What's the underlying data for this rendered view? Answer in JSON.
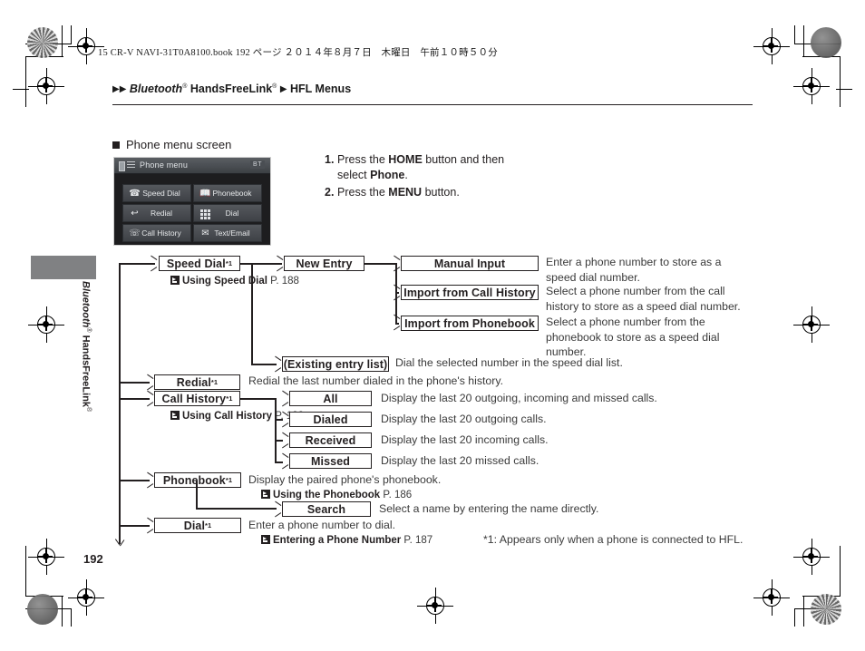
{
  "header": {
    "filestamp": "15 CR-V NAVI-31T0A8100.book   192 ページ   ２０１４年８月７日　木曜日　午前１０時５０分",
    "breadcrumb_1": "Bluetooth",
    "breadcrumb_1_sup": "®",
    "breadcrumb_2": "HandsFreeLink",
    "breadcrumb_2_sup": "®",
    "breadcrumb_3": "HFL Menus"
  },
  "sidebar": {
    "label_1": "Bluetooth",
    "label_1_sup": "®",
    "label_2": "HandsFreeLink",
    "label_2_sup": "®"
  },
  "section": {
    "title": "Phone menu screen"
  },
  "device": {
    "title": "Phone menu",
    "status_right": "BT",
    "buttons": [
      {
        "label": "Speed Dial",
        "icon": "speed-dial-icon"
      },
      {
        "label": "Phonebook",
        "icon": "phonebook-icon"
      },
      {
        "label": "Redial",
        "icon": "redial-icon"
      },
      {
        "label": "Dial",
        "icon": "keypad-icon"
      },
      {
        "label": "Call History",
        "icon": "call-history-icon"
      },
      {
        "label": "Text/Email",
        "icon": "envelope-icon"
      }
    ]
  },
  "steps": [
    {
      "num": "1.",
      "pre": "Press the ",
      "bold1": "HOME",
      "mid": " button and then",
      "line2_pre": "select ",
      "bold2": "Phone",
      "line2_post": "."
    },
    {
      "num": "2.",
      "pre": "Press the ",
      "bold1": "MENU",
      "mid": " button.",
      "line2_pre": "",
      "bold2": "",
      "line2_post": ""
    }
  ],
  "flow": {
    "speed_dial": {
      "label": "Speed Dial",
      "sup": "*1"
    },
    "speed_dial_ref": {
      "bold": "Using Speed Dial",
      "page": "P. 188"
    },
    "new_entry": {
      "label": "New Entry"
    },
    "manual_input": {
      "label": "Manual Input"
    },
    "manual_input_desc": "Enter a phone number to store as a speed dial number.",
    "import_call_history": {
      "label": "Import from Call History"
    },
    "import_call_history_desc": "Select a phone number from the call history to store as a speed dial number.",
    "import_phonebook": {
      "label": "Import from Phonebook"
    },
    "import_phonebook_desc": "Select a phone number from the phonebook to store as a speed dial number.",
    "existing_entry": {
      "label": "(Existing entry list)"
    },
    "existing_entry_desc": "Dial the selected number in the speed dial list.",
    "redial": {
      "label": "Redial",
      "sup": "*1"
    },
    "redial_desc": "Redial the last number dialed in the phone's history.",
    "call_history": {
      "label": "Call History",
      "sup": "*1"
    },
    "call_history_ref": {
      "bold": "Using Call History",
      "page": "P. 188"
    },
    "all": {
      "label": "All"
    },
    "all_desc": "Display the last 20 outgoing, incoming and missed calls.",
    "dialed": {
      "label": "Dialed"
    },
    "dialed_desc": "Display the last 20 outgoing calls.",
    "received": {
      "label": "Received"
    },
    "received_desc": "Display the last 20 incoming calls.",
    "missed": {
      "label": "Missed"
    },
    "missed_desc": "Display the last 20 missed calls.",
    "phonebook": {
      "label": "Phonebook",
      "sup": "*1"
    },
    "phonebook_desc": "Display the paired phone's phonebook.",
    "phonebook_ref": {
      "bold": "Using the Phonebook",
      "page": "P. 186"
    },
    "search": {
      "label": "Search"
    },
    "search_desc": "Select a name by entering the name directly.",
    "dial": {
      "label": "Dial",
      "sup": "*1"
    },
    "dial_desc": "Enter a phone number to dial.",
    "dial_ref": {
      "bold": "Entering a Phone Number",
      "page": "P. 187"
    }
  },
  "footnote": "*1: Appears only when a phone is connected to HFL.",
  "page_number": "192",
  "colors": {
    "ink": "#231f20",
    "tab_gray": "#808183",
    "body_text": "#3a3a3a"
  }
}
